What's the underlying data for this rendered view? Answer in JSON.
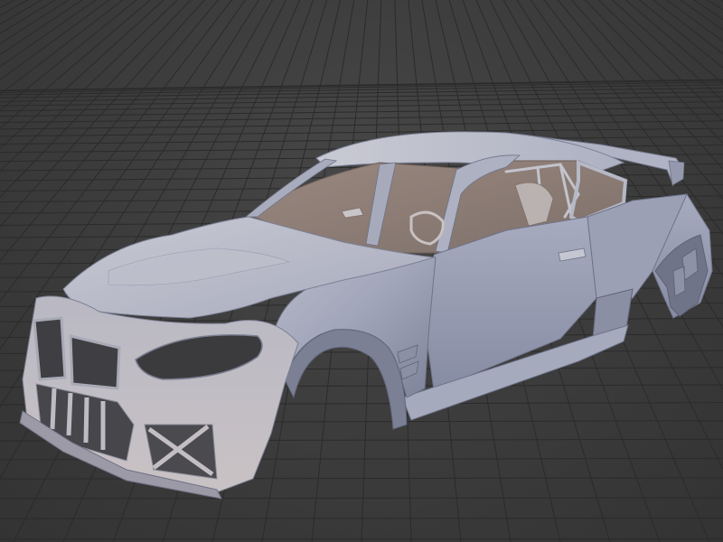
{
  "viewport": {
    "background_color": "#3d3d3d",
    "grid_color": "#2b2b2b",
    "model_color": "#9ea3b8",
    "interior_color": "#8a7a72",
    "model": "widebody-coupe-body-shell",
    "shading": "solid-clay"
  }
}
